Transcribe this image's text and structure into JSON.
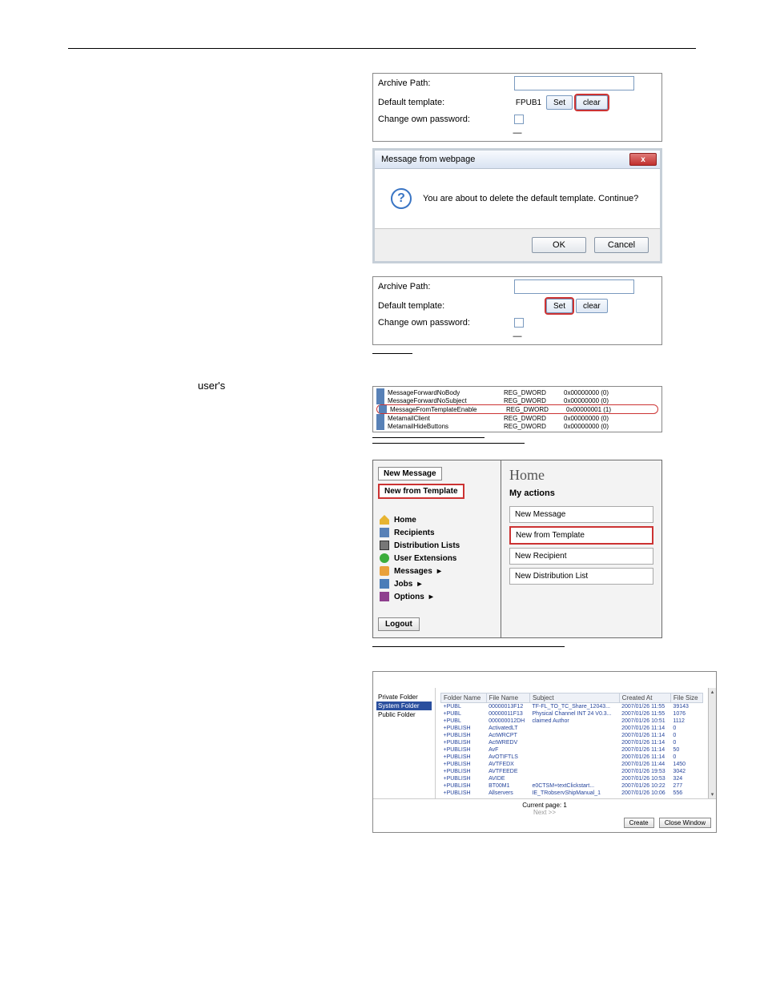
{
  "form1": {
    "archive_label": "Archive Path:",
    "template_label": "Default template:",
    "template_value": "FPUB1",
    "set_label": "Set",
    "clear_label": "clear",
    "pw_label": "Change own password:"
  },
  "msgbox": {
    "title": "Message from webpage",
    "body": "You are about to delete the default template. Continue?",
    "ok": "OK",
    "cancel": "Cancel",
    "close": "x"
  },
  "form2": {
    "archive_label": "Archive Path:",
    "template_label": "Default template:",
    "set_label": "Set",
    "clear_label": "clear",
    "pw_label": "Change own password:"
  },
  "side_word": "user's",
  "registry": {
    "rows": [
      {
        "name": "MessageForwardNoBody",
        "type": "REG_DWORD",
        "val": "0x00000000 (0)"
      },
      {
        "name": "MessageForwardNoSubject",
        "type": "REG_DWORD",
        "val": "0x00000000 (0)"
      },
      {
        "name": "MessageFromTemplateEnable",
        "type": "REG_DWORD",
        "val": "0x00000001 (1)",
        "hi": true
      },
      {
        "name": "MetamailClient",
        "type": "REG_DWORD",
        "val": "0x00000000 (0)"
      },
      {
        "name": "MetamailHideButtons",
        "type": "REG_DWORD",
        "val": "0x00000000 (0)"
      }
    ]
  },
  "nav": {
    "new_message": "New Message",
    "new_from_template": "New from Template",
    "home": "Home",
    "recipients": "Recipients",
    "dist": "Distribution Lists",
    "ext": "User Extensions",
    "messages": "Messages",
    "jobs": "Jobs",
    "options": "Options",
    "logout": "Logout"
  },
  "right": {
    "home": "Home",
    "my_actions": "My actions",
    "a1": "New Message",
    "a2": "New from Template",
    "a3": "New Recipient",
    "a4": "New Distribution List"
  },
  "chooser": {
    "folders": {
      "priv": "Private Folder",
      "sys": "System Folder",
      "pub": "Public Folder"
    },
    "headers": {
      "folder": "Folder Name",
      "file": "File Name",
      "subject": "Subject",
      "created": "Created At",
      "size": "File Size"
    },
    "rows": [
      {
        "folder": "+PUBL",
        "file": "00000013F12",
        "subject": "TF-FL_TO_TC_Share_12043...",
        "created": "2007/01/26 11:55",
        "size": "39143"
      },
      {
        "folder": "+PUBL",
        "file": "00000011F13",
        "subject": "Physical Channel INT 24 V0.3...",
        "created": "2007/01/26 11:55",
        "size": "1076"
      },
      {
        "folder": "+PUBL",
        "file": "000000012DH",
        "subject": "claimed Author",
        "created": "2007/01/26 10:51",
        "size": "1112"
      },
      {
        "folder": "+PUBLISH",
        "file": "ActivatedLT",
        "subject": "",
        "created": "2007/01/26 11:14",
        "size": "0"
      },
      {
        "folder": "+PUBLISH",
        "file": "ActWRCPT",
        "subject": "",
        "created": "2007/01/26 11:14",
        "size": "0"
      },
      {
        "folder": "+PUBLISH",
        "file": "ActWREDV",
        "subject": "",
        "created": "2007/01/26 11:14",
        "size": "0"
      },
      {
        "folder": "+PUBLISH",
        "file": "AvF",
        "subject": "",
        "created": "2007/01/26 11:14",
        "size": "50"
      },
      {
        "folder": "+PUBLISH",
        "file": "AvOTIFTLS",
        "subject": "",
        "created": "2007/01/26 11:14",
        "size": "0"
      },
      {
        "folder": "+PUBLISH",
        "file": "AVTFEDX",
        "subject": "",
        "created": "2007/01/26 11:44",
        "size": "1450"
      },
      {
        "folder": "+PUBLISH",
        "file": "AVTFEEDE",
        "subject": "",
        "created": "2007/01/26 19:53",
        "size": "3042"
      },
      {
        "folder": "+PUBLISH",
        "file": "AVIDE",
        "subject": "",
        "created": "2007/01/26 10:53",
        "size": "324"
      },
      {
        "folder": "+PUBLISH",
        "file": "BT00M1",
        "subject": "e0CTSM+textClickstart...",
        "created": "2007/01/26 10:22",
        "size": "277"
      },
      {
        "folder": "+PUBLISH",
        "file": "Allservers",
        "subject": "IE_TRobservShipManual_1",
        "created": "2007/01/26 10:06",
        "size": "556"
      }
    ],
    "page_label": "Current page: 1",
    "next": "Next >>",
    "create": "Create",
    "close": "Close Window"
  }
}
